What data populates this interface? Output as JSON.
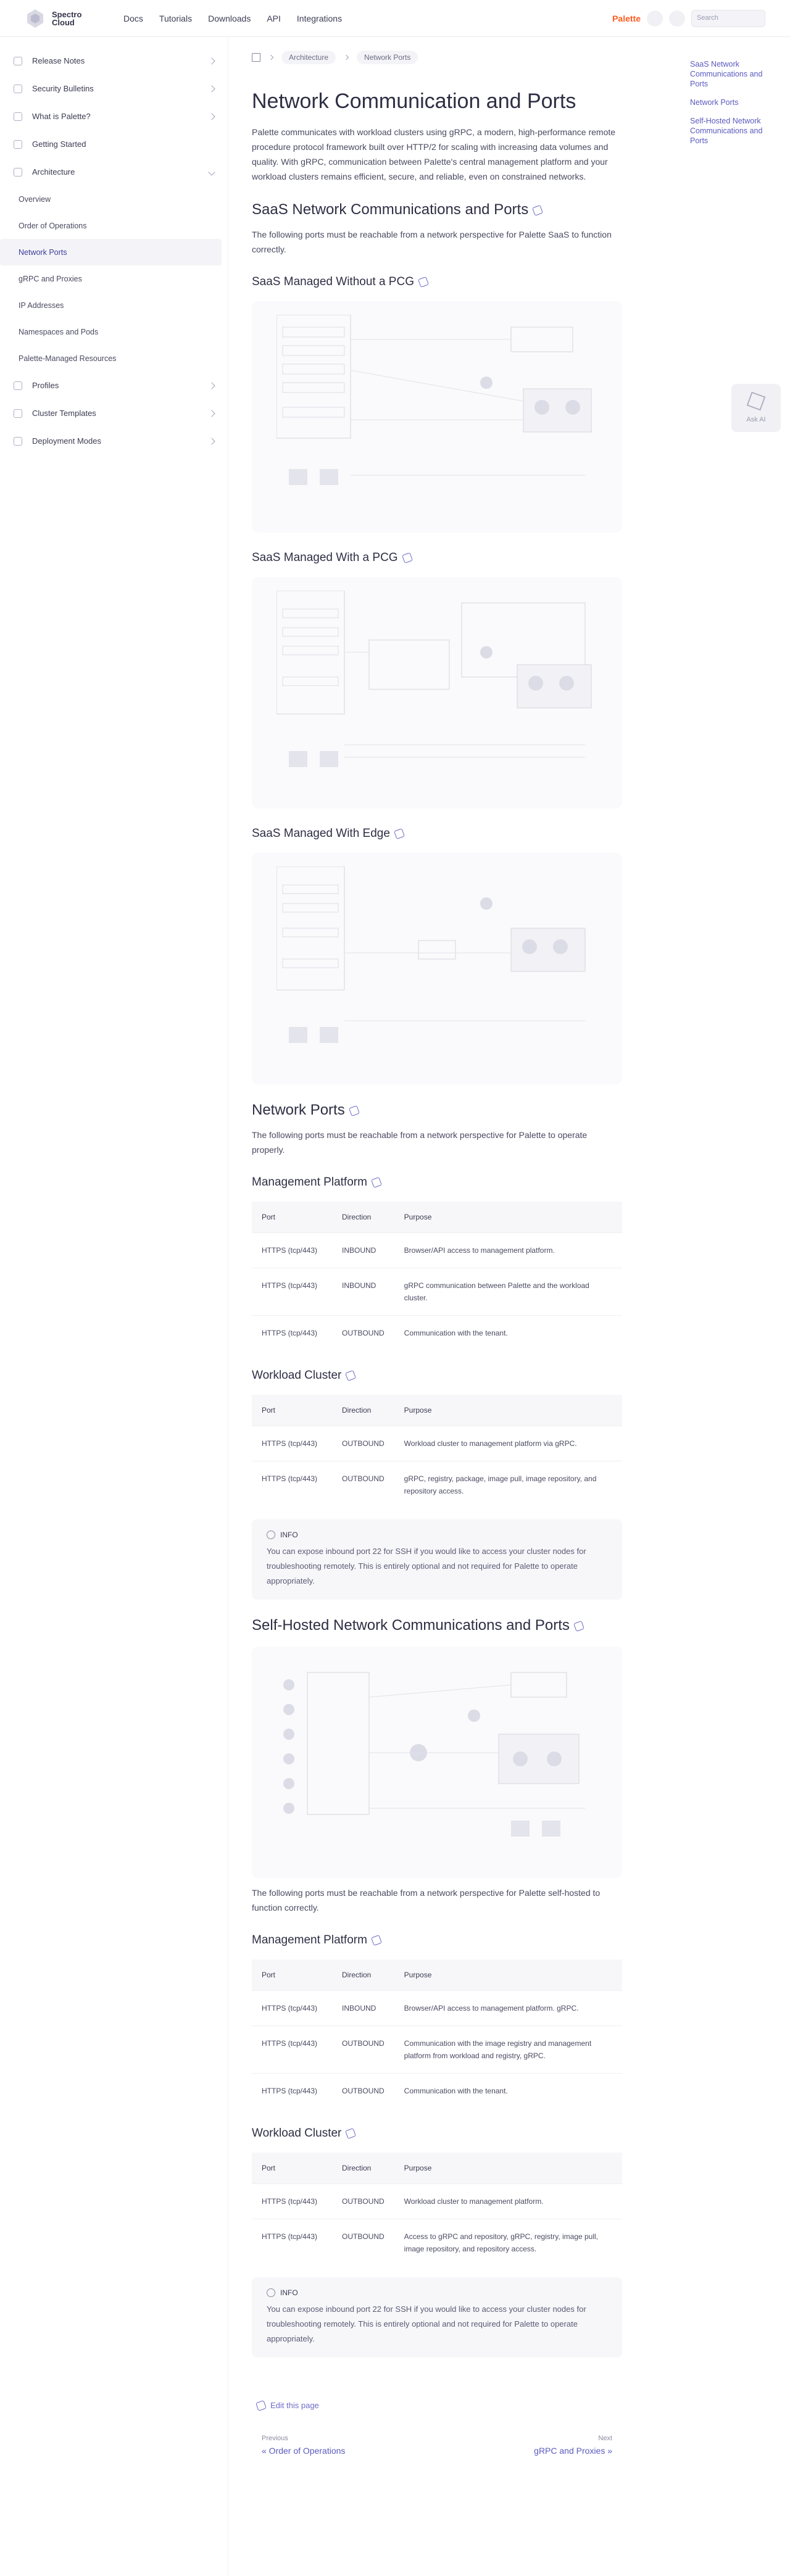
{
  "brand": {
    "line1": "Spectro",
    "line2": "Cloud"
  },
  "nav": {
    "links": [
      "Docs",
      "Tutorials",
      "Downloads",
      "API",
      "Integrations"
    ],
    "search_placeholder": "Search",
    "feature_badge": "Palette"
  },
  "sidebar": {
    "items": [
      {
        "label": "Release Notes"
      },
      {
        "label": "Security Bulletins"
      },
      {
        "label": "What is Palette?"
      },
      {
        "label": "Getting Started"
      },
      {
        "label": "Architecture"
      }
    ],
    "sub_items": [
      "Overview",
      "Order of Operations",
      "Network Ports",
      "gRPC and Proxies",
      "IP Addresses",
      "Namespaces and Pods",
      "Palette-Managed Resources"
    ],
    "bottom_items": [
      {
        "label": "Profiles"
      },
      {
        "label": "Cluster Templates"
      },
      {
        "label": "Deployment Modes"
      }
    ]
  },
  "breadcrumb": [
    "Architecture",
    "Network Ports"
  ],
  "page": {
    "title": "Network Communication and Ports",
    "intro": "Palette communicates with workload clusters using gRPC, a modern, high-performance remote procedure protocol framework built over HTTP/2 for scaling with increasing data volumes and quality. With gRPC, communication between Palette's central management platform and your workload clusters remains efficient, secure, and reliable, even on constrained networks.",
    "saas_heading": "SaaS Network Communications and Ports",
    "saas_desc": "The following ports must be reachable from a network perspective for Palette SaaS to function correctly.",
    "pcg_none": "SaaS Managed Without a PCG",
    "pcg_with": "SaaS Managed With a PCG",
    "edge": "SaaS Managed With Edge",
    "ports_heading": "Network Ports",
    "ports_desc": "The following ports must be reachable from a network perspective for Palette to operate properly.",
    "mgmt_heading": "Management Platform",
    "workload_heading": "Workload Cluster",
    "table_headers": [
      "Port",
      "Direction",
      "Purpose"
    ],
    "mgmt_rows": [
      {
        "port": "HTTPS (tcp/443)",
        "dir": "INBOUND",
        "purpose": "Browser/API access to management platform."
      },
      {
        "port": "HTTPS (tcp/443)",
        "dir": "INBOUND",
        "purpose": "gRPC communication between Palette and the workload cluster."
      },
      {
        "port": "HTTPS (tcp/443)",
        "dir": "OUTBOUND",
        "purpose": "Communication with the tenant."
      }
    ],
    "workload_rows": [
      {
        "port": "HTTPS (tcp/443)",
        "dir": "OUTBOUND",
        "purpose": "Workload cluster to management platform via gRPC."
      },
      {
        "port": "HTTPS (tcp/443)",
        "dir": "OUTBOUND",
        "purpose": "gRPC, registry, package, image pull, image repository, and repository access."
      }
    ],
    "note_label": "INFO",
    "note_body": "You can expose inbound port 22 for SSH if you would like to access your cluster nodes for troubleshooting remotely. This is entirely optional and not required for Palette to operate appropriately.",
    "self_heading": "Self-Hosted Network Communications and Ports",
    "self_desc": "The following ports must be reachable from a network perspective for Palette self-hosted to function correctly.",
    "self_mgmt_rows": [
      {
        "port": "HTTPS (tcp/443)",
        "dir": "INBOUND",
        "purpose": "Browser/API access to management platform. gRPC."
      },
      {
        "port": "HTTPS (tcp/443)",
        "dir": "OUTBOUND",
        "purpose": "Communication with the image registry and management platform from workload and registry, gRPC."
      },
      {
        "port": "HTTPS (tcp/443)",
        "dir": "OUTBOUND",
        "purpose": "Communication with the tenant."
      }
    ],
    "self_workload_rows": [
      {
        "port": "HTTPS (tcp/443)",
        "dir": "OUTBOUND",
        "purpose": "Workload cluster to management platform."
      },
      {
        "port": "HTTPS (tcp/443)",
        "dir": "OUTBOUND",
        "purpose": "Access to gRPC and repository, gRPC, registry, image pull, image repository, and repository access."
      }
    ],
    "self_note_body": "You can expose inbound port 22 for SSH if you would like to access your cluster nodes for troubleshooting remotely. This is entirely optional and not required for Palette to operate appropriately.",
    "edit_link": "Edit this page",
    "prev_small": "Previous",
    "prev_big": "« Order of Operations",
    "next_small": "Next",
    "next_big": "gRPC and Proxies »"
  },
  "toc": [
    "SaaS Network Communications and Ports",
    "Network Ports",
    "Self-Hosted Network Communications and Ports"
  ],
  "feedback": {
    "label": "Ask AI"
  }
}
